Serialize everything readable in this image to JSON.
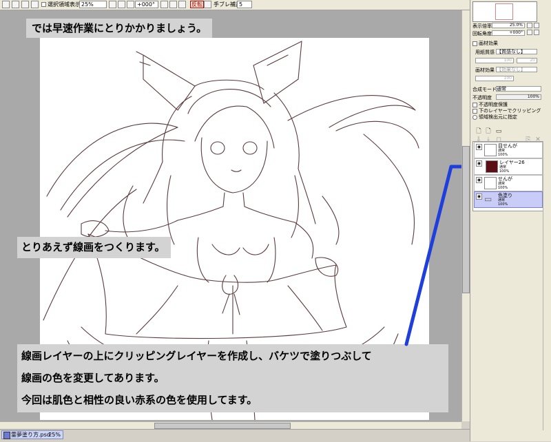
{
  "toolbar": {
    "select_area_label": "選択領域表示",
    "zoom": "25%",
    "rotation": "+000°",
    "flip_label": "反転",
    "stabilizer_label": "手ブレ補正",
    "stabilizer_value": "5"
  },
  "captions": {
    "intro": "では早速作業にとりかかりましょう。",
    "lineart": "とりあえず線画をつくります。",
    "clip_line1": "線画レイヤーの上にクリッピングレイヤーを作成し、バケツで塗りつぶして",
    "clip_line2": "線画の色を変更してあります。",
    "clip_line3": "今回は肌色と相性の良い赤系の色を使用してます。"
  },
  "panel": {
    "zoom_label": "表示倍率",
    "zoom_value": "25.0%",
    "angle_label": "回転角度",
    "angle_value": "+000°",
    "texture_section": "画材効果",
    "paper_label": "用紙質感",
    "paper_value": "【質感なし】",
    "paper_num1": "100",
    "paper_num2": "20",
    "brush_label": "画材効果",
    "brush_value": "【効果なし】",
    "brush_num1": "100",
    "blend_label": "合成モード",
    "blend_value": "通常",
    "opacity_label": "不透明度",
    "opacity_value": "100%",
    "protect_label": "不透明度保護",
    "clip_label": "下のレイヤーでクリッピング",
    "source_label": "領域検出元に指定"
  },
  "layers": [
    {
      "name": "目せんが",
      "mode": "通常",
      "opacity": "100%",
      "color": "#ffffff",
      "selected": false
    },
    {
      "name": "レイヤー26",
      "mode": "通常",
      "opacity": "100%",
      "color": "#5a0f14",
      "selected": false
    },
    {
      "name": "せんが",
      "mode": "通常",
      "opacity": "100%",
      "color": "#ffffff",
      "selected": false
    },
    {
      "name": "色塗り",
      "mode": "通常",
      "opacity": "100%",
      "color": "#c9ccf6",
      "selected": true
    }
  ],
  "file_tab": {
    "filename": "霊夢塗り方.psd",
    "zoom": "25%"
  },
  "colors": {
    "annotation": "#1f3fdd",
    "lineart": "#5b3a3d",
    "layer_selected": "#c9ccf6"
  }
}
